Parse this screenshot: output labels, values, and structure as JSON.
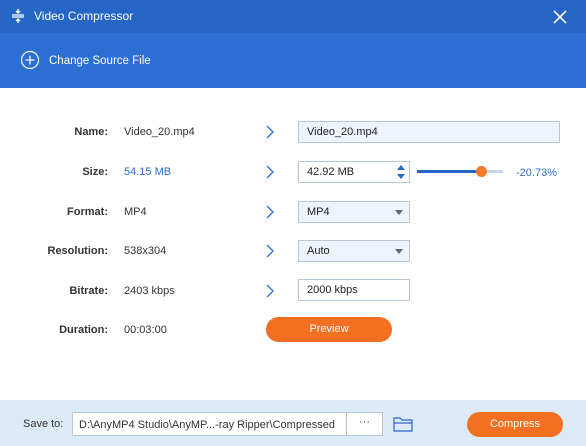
{
  "window": {
    "title": "Video Compressor"
  },
  "toolbar": {
    "change_source_label": "Change Source File"
  },
  "form": {
    "name": {
      "label": "Name:",
      "value": "Video_20.mp4",
      "output": "Video_20.mp4"
    },
    "size": {
      "label": "Size:",
      "value": "54.15 MB",
      "output": "42.92 MB",
      "percent": "-20.73%",
      "slider_fraction": 0.75
    },
    "format": {
      "label": "Format:",
      "value": "MP4",
      "selected": "MP4"
    },
    "resolution": {
      "label": "Resolution:",
      "value": "538x304",
      "selected": "Auto"
    },
    "bitrate": {
      "label": "Bitrate:",
      "value": "2403 kbps",
      "output": "2000 kbps"
    },
    "duration": {
      "label": "Duration:",
      "value": "00:03:00"
    }
  },
  "buttons": {
    "preview": "Preview",
    "compress": "Compress"
  },
  "footer": {
    "save_label": "Save to:",
    "path": "D:\\AnyMP4 Studio\\AnyMP...-ray Ripper\\Compressed",
    "more": "···"
  },
  "colors": {
    "title_bar": "#2566c6",
    "source_bar": "#2a6fd1",
    "accent": "#f36f21",
    "footer_bg": "#ddeaf8"
  },
  "icons": {
    "title": "compress-icon",
    "close": "close-icon",
    "add": "plus-circle-icon",
    "row_arrow": "chevron-right-icon",
    "folder": "folder-icon",
    "spin": "spin-arrows-icon"
  }
}
